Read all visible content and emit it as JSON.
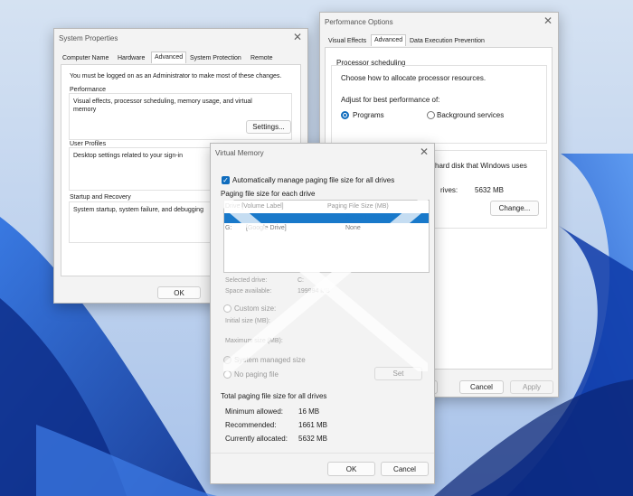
{
  "colors": {
    "accent": "#0f6cbd",
    "window_bg": "#f3f3f3",
    "selection": "#1979ca",
    "wallpaper_blue": "#1f5fd1"
  },
  "system_properties": {
    "title": "System Properties",
    "tabs": [
      "Computer Name",
      "Hardware",
      "Advanced",
      "System Protection",
      "Remote"
    ],
    "admin_notice": "You must be logged on as an Administrator to make most of these changes.",
    "performance": {
      "heading": "Performance",
      "description_line1": "Visual effects, processor scheduling, memory usage, and virtual",
      "description_line2": "memory",
      "settings_button": "Settings..."
    },
    "user_profiles": {
      "heading": "User Profiles",
      "description": "Desktop settings related to your sign-in"
    },
    "startup_recovery": {
      "heading": "Startup and Recovery",
      "description": "System startup, system failure, and debugging"
    },
    "ok_button": "OK"
  },
  "performance_options": {
    "title": "Performance Options",
    "tabs": [
      "Visual Effects",
      "Advanced",
      "Data Execution Prevention"
    ],
    "processor_scheduling": {
      "heading": "Processor scheduling",
      "description": "Choose how to allocate processor resources.",
      "adjust_label": "Adjust for best performance of:",
      "option_programs": "Programs",
      "option_background": "Background services"
    },
    "virtual_memory_partial": {
      "text": "hard disk that Windows uses",
      "drives_label": "rives:",
      "drives_value": "5632 MB",
      "change_button": "Change..."
    },
    "ok_fragment": "K",
    "cancel_button": "Cancel",
    "apply_button": "Apply"
  },
  "virtual_memory": {
    "title": "Virtual Memory",
    "auto_manage_label": "Automatically manage paging file size for all drives",
    "paging_section_label": "Paging file size for each drive",
    "columns": {
      "drive": "Drive  [Volume Label]",
      "paging_size": "Paging File Size (MB)"
    },
    "drives": [
      {
        "drive": "C:",
        "label": "",
        "size": "System managed"
      },
      {
        "drive": "G:",
        "label": "[Google Drive]",
        "size": "None"
      }
    ],
    "selected_drive_label": "Selected drive:",
    "selected_drive_value": "C:",
    "space_available_label": "Space available:",
    "space_available_value": "199994 MB",
    "custom_size_label": "Custom size:",
    "initial_size_label": "Initial size (MB):",
    "maximum_size_label": "Maximum size (MB):",
    "system_managed_label": "System managed size",
    "no_paging_label": "No paging file",
    "set_button": "Set",
    "total_heading": "Total paging file size for all drives",
    "minimum_label": "Minimum allowed:",
    "minimum_value": "16 MB",
    "recommended_label": "Recommended:",
    "recommended_value": "1661 MB",
    "allocated_label": "Currently allocated:",
    "allocated_value": "5632 MB",
    "ok_button": "OK",
    "cancel_button": "Cancel"
  }
}
